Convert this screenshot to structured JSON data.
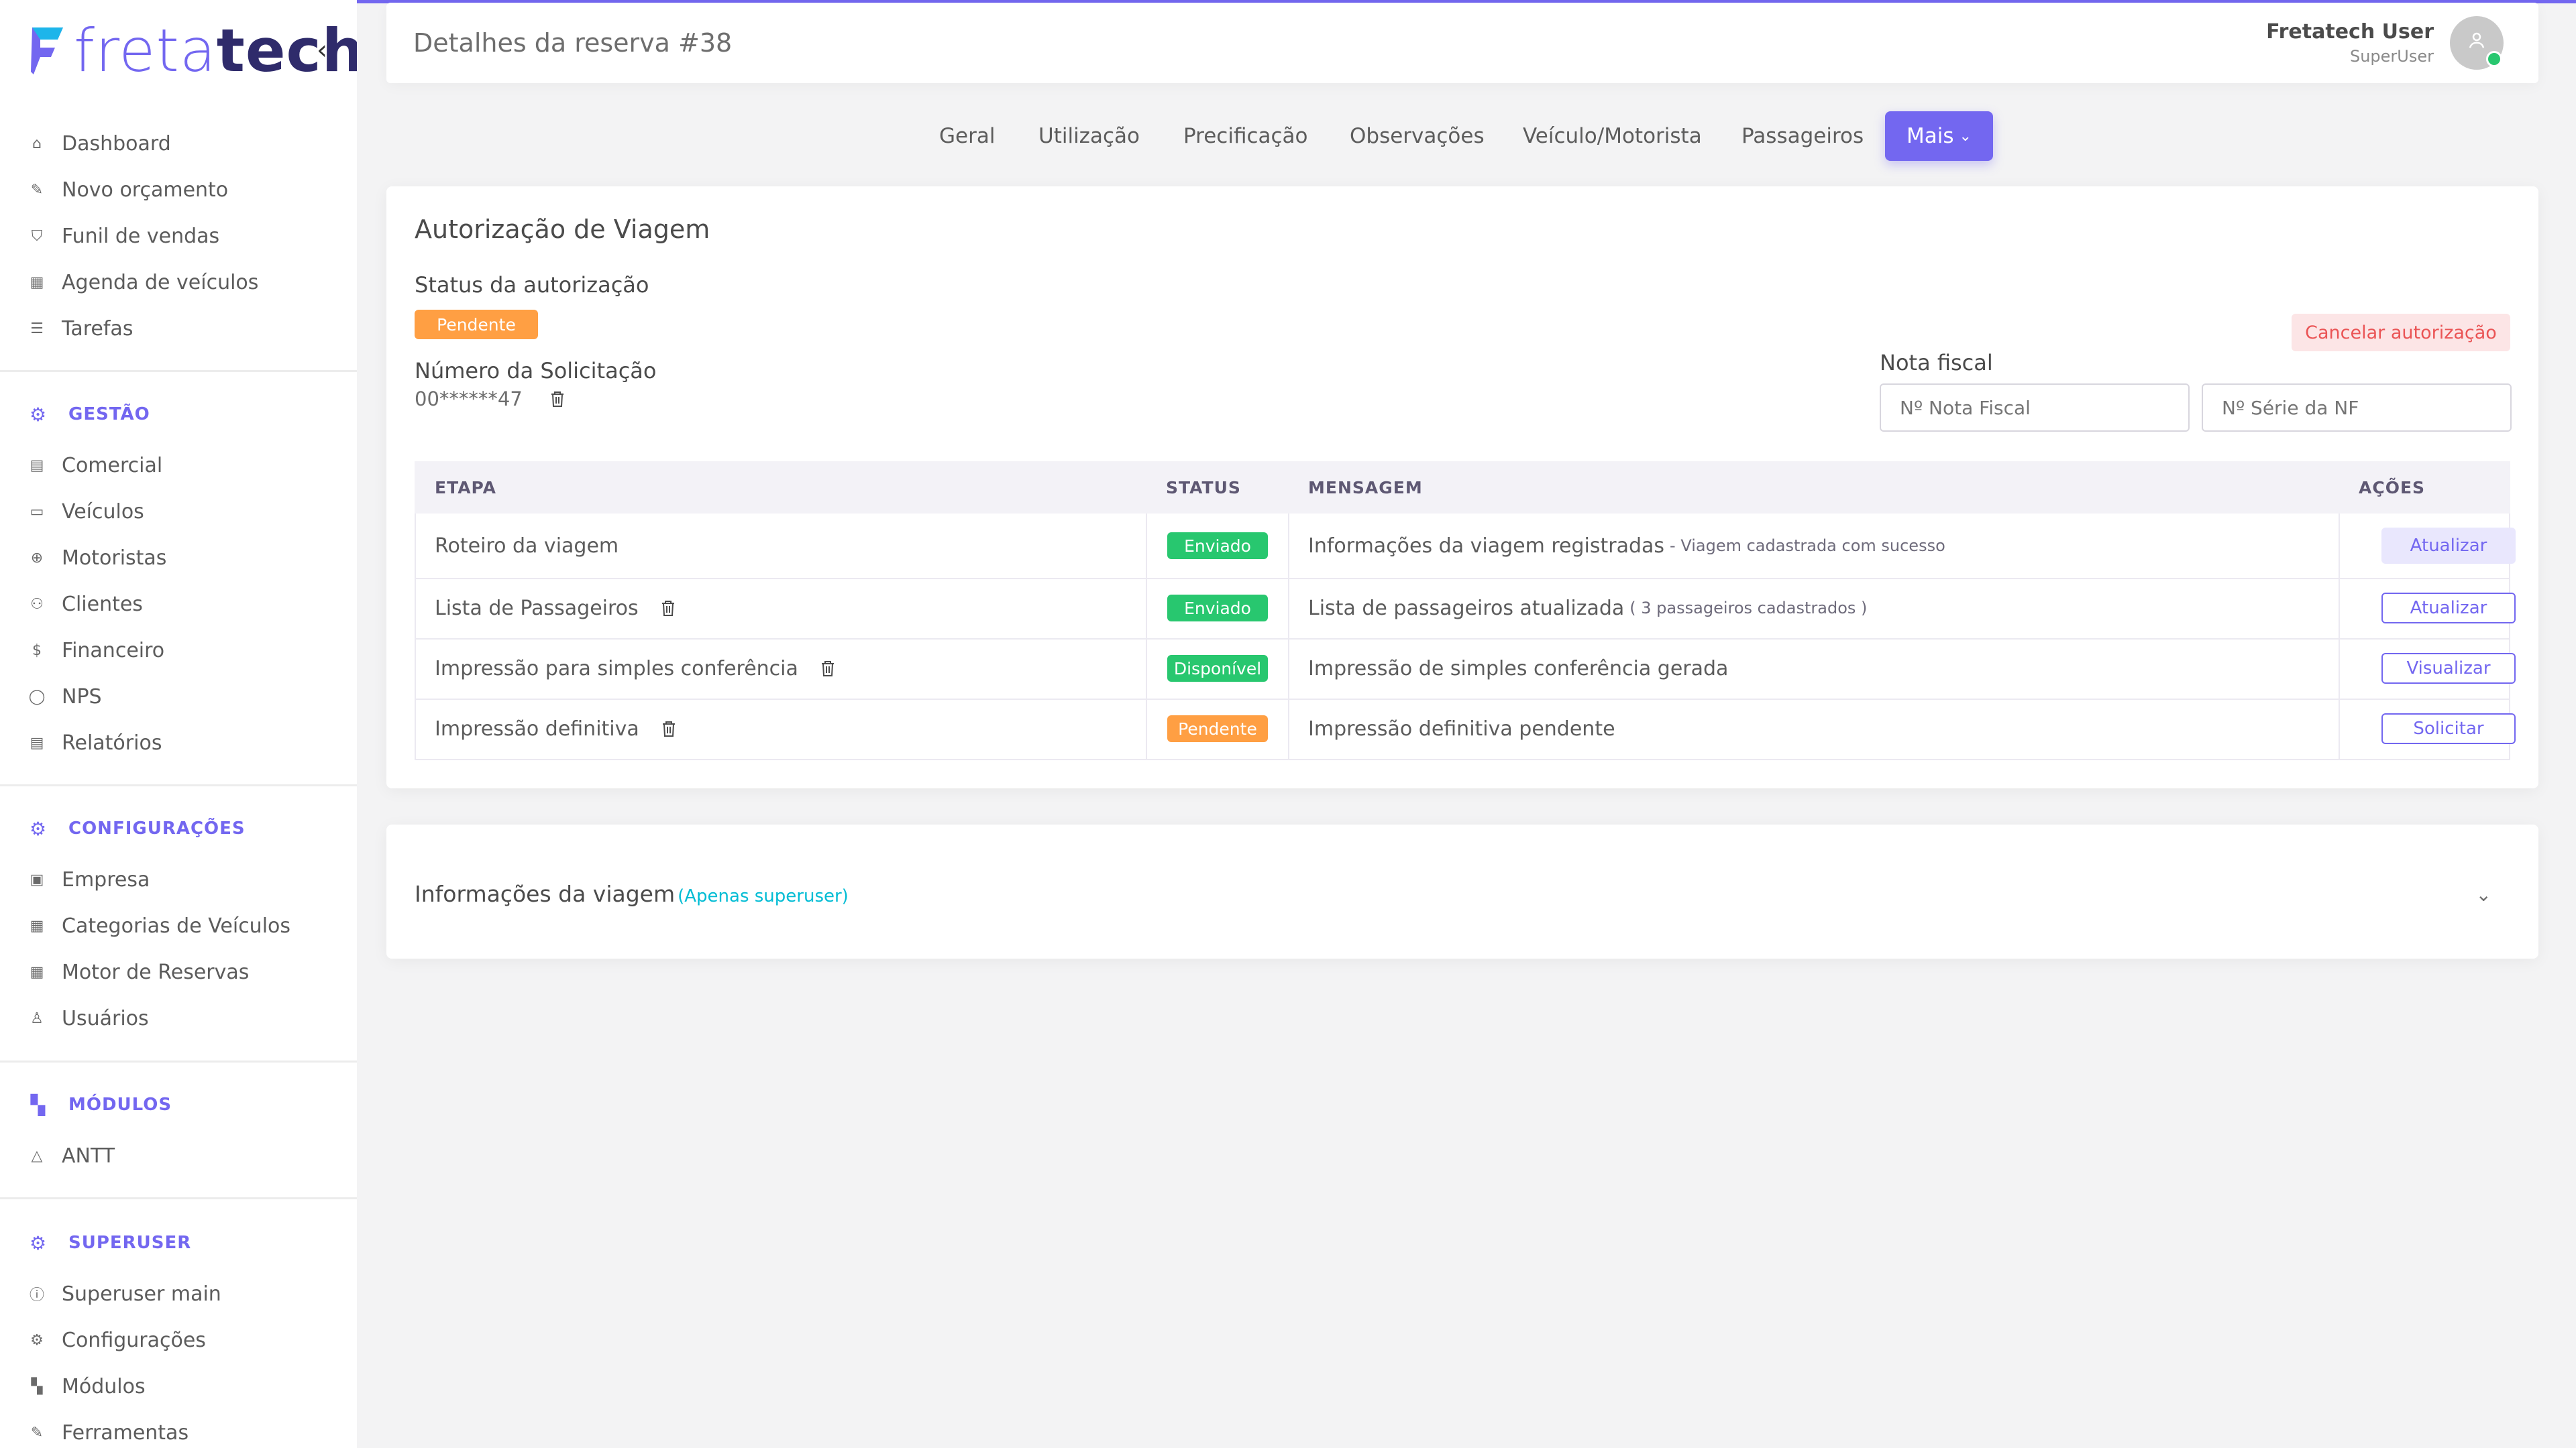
{
  "brand": {
    "logo_light": "freta",
    "logo_bold": "tech",
    "accent": "#7367f0"
  },
  "sidebar": {
    "collapse_icon": "chevron-left-icon",
    "items": [
      {
        "label": "Dashboard",
        "icon": "home-icon"
      },
      {
        "label": "Novo orçamento",
        "icon": "edit-icon"
      },
      {
        "label": "Funil de vendas",
        "icon": "funnel-icon"
      },
      {
        "label": "Agenda de veículos",
        "icon": "calendar-icon"
      },
      {
        "label": "Tarefas",
        "icon": "list-icon"
      }
    ],
    "sections": [
      {
        "title": "GESTÃO",
        "icon": "gear-icon",
        "items": [
          {
            "label": "Comercial",
            "icon": "file-icon"
          },
          {
            "label": "Veículos",
            "icon": "bus-icon"
          },
          {
            "label": "Motoristas",
            "icon": "steering-wheel-icon"
          },
          {
            "label": "Clientes",
            "icon": "users-icon"
          },
          {
            "label": "Financeiro",
            "icon": "dollar-icon"
          },
          {
            "label": "NPS",
            "icon": "message-icon"
          },
          {
            "label": "Relatórios",
            "icon": "report-icon"
          }
        ]
      },
      {
        "title": "CONFIGURAÇÕES",
        "icon": "gear-icon",
        "items": [
          {
            "label": "Empresa",
            "icon": "briefcase-icon"
          },
          {
            "label": "Categorias de Veículos",
            "icon": "grid-icon"
          },
          {
            "label": "Motor de Reservas",
            "icon": "table-icon"
          },
          {
            "label": "Usuários",
            "icon": "user-icon"
          }
        ]
      },
      {
        "title": "MÓDULOS",
        "icon": "modules-icon",
        "items": [
          {
            "label": "ANTT",
            "icon": "triangle-icon"
          }
        ]
      },
      {
        "title": "SUPERUSER",
        "icon": "gear-icon",
        "items": [
          {
            "label": "Superuser main",
            "icon": "info-icon"
          },
          {
            "label": "Configurações",
            "icon": "gear-icon"
          },
          {
            "label": "Módulos",
            "icon": "modules-icon"
          },
          {
            "label": "Ferramentas",
            "icon": "tool-icon"
          }
        ]
      }
    ]
  },
  "header": {
    "title": "Detalhes da reserva #38",
    "user_name": "Fretatech User",
    "user_role": "SuperUser",
    "avatar_icon": "user-icon",
    "online_color": "#28c76f"
  },
  "tabs": [
    "Geral",
    "Utilização",
    "Precificação",
    "Observações",
    "Veículo/Motorista",
    "Passageiros"
  ],
  "tab_more": "Mais",
  "authorization": {
    "title": "Autorização de Viagem",
    "status_label": "Status da autorização",
    "status_value": "Pendente",
    "request_label": "Número da Solicitação",
    "request_value": "00******47",
    "cancel_button": "Cancelar autorização",
    "invoice_label": "Nota fiscal",
    "invoice_number_placeholder": "Nº Nota Fiscal",
    "invoice_series_placeholder": "Nº Série da NF"
  },
  "table": {
    "headers": [
      "ETAPA",
      "STATUS",
      "MENSAGEM",
      "AÇÕES"
    ],
    "rows": [
      {
        "step": "Roteiro da viagem",
        "status": "Enviado",
        "status_color": "green",
        "message": "Informações da viagem registradas",
        "detail": "- Viagem cadastrada com sucesso",
        "action": "Atualizar",
        "action_style": "soft",
        "trash": false
      },
      {
        "step": "Lista de Passageiros",
        "status": "Enviado",
        "status_color": "green",
        "message": "Lista de passageiros atualizada",
        "detail": "( 3 passageiros cadastrados )",
        "action": "Atualizar",
        "action_style": "outline",
        "trash": true
      },
      {
        "step": "Impressão para simples conferência",
        "status": "Disponível",
        "status_color": "green",
        "message": "Impressão de simples conferência gerada",
        "detail": "",
        "action": "Visualizar",
        "action_style": "outline",
        "trash": true
      },
      {
        "step": "Impressão definitiva",
        "status": "Pendente",
        "status_color": "orange",
        "message": "Impressão definitiva pendente",
        "detail": "",
        "action": "Solicitar",
        "action_style": "outline",
        "trash": true
      }
    ]
  },
  "trip_info": {
    "title": "Informações da viagem",
    "hint": "(Apenas superuser)"
  }
}
